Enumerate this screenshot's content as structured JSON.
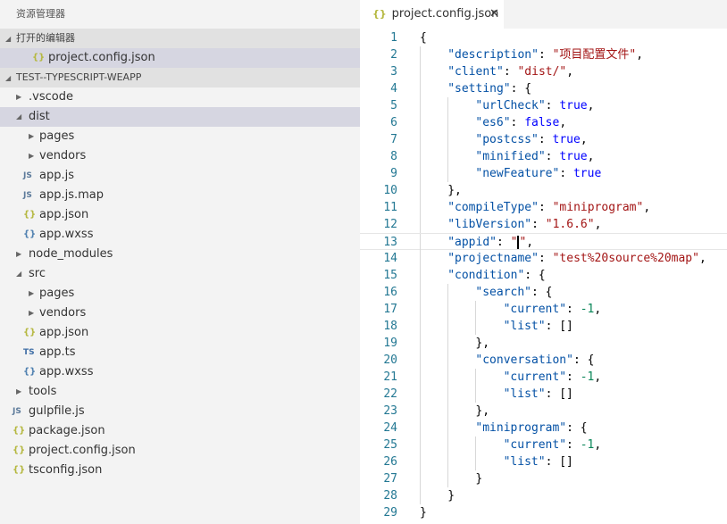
{
  "sidebar": {
    "title": "资源管理器",
    "open_editors_label": "打开的编辑器",
    "open_editors": [
      {
        "name": "project.config.json",
        "icon": "json"
      }
    ],
    "project_label": "TEST--TYPESCRIPT-WEAPP",
    "tree": [
      {
        "name": ".vscode",
        "type": "folder",
        "depth": 0,
        "expanded": false
      },
      {
        "name": "dist",
        "type": "folder",
        "depth": 0,
        "expanded": true,
        "selected": true
      },
      {
        "name": "pages",
        "type": "folder",
        "depth": 1,
        "expanded": false
      },
      {
        "name": "vendors",
        "type": "folder",
        "depth": 1,
        "expanded": false
      },
      {
        "name": "app.js",
        "type": "file",
        "icon": "js",
        "icon_text": "JS",
        "depth": 1
      },
      {
        "name": "app.js.map",
        "type": "file",
        "icon": "js",
        "icon_text": "JS",
        "depth": 1
      },
      {
        "name": "app.json",
        "type": "file",
        "icon": "json",
        "icon_text": "{}",
        "depth": 1
      },
      {
        "name": "app.wxss",
        "type": "file",
        "icon": "wxss",
        "icon_text": "{}",
        "depth": 1
      },
      {
        "name": "node_modules",
        "type": "folder",
        "depth": 0,
        "expanded": false
      },
      {
        "name": "src",
        "type": "folder",
        "depth": 0,
        "expanded": true
      },
      {
        "name": "pages",
        "type": "folder",
        "depth": 1,
        "expanded": false
      },
      {
        "name": "vendors",
        "type": "folder",
        "depth": 1,
        "expanded": false
      },
      {
        "name": "app.json",
        "type": "file",
        "icon": "json",
        "icon_text": "{}",
        "depth": 1
      },
      {
        "name": "app.ts",
        "type": "file",
        "icon": "ts",
        "icon_text": "TS",
        "depth": 1
      },
      {
        "name": "app.wxss",
        "type": "file",
        "icon": "wxss",
        "icon_text": "{}",
        "depth": 1
      },
      {
        "name": "tools",
        "type": "folder",
        "depth": 0,
        "expanded": false
      },
      {
        "name": "gulpfile.js",
        "type": "file",
        "icon": "js",
        "icon_text": "JS",
        "depth": 0
      },
      {
        "name": "package.json",
        "type": "file",
        "icon": "json",
        "icon_text": "{}",
        "depth": 0
      },
      {
        "name": "project.config.json",
        "type": "file",
        "icon": "json",
        "icon_text": "{}",
        "depth": 0
      },
      {
        "name": "tsconfig.json",
        "type": "file",
        "icon": "json",
        "icon_text": "{}",
        "depth": 0
      }
    ]
  },
  "editor": {
    "tab": {
      "label": "project.config.json",
      "icon_text": "{}",
      "close": "✕"
    },
    "cursor_line": 13,
    "lines": [
      [
        0,
        [
          [
            "p",
            "{"
          ]
        ]
      ],
      [
        1,
        [
          [
            "k",
            "\"description\""
          ],
          [
            "p",
            ": "
          ],
          [
            "s",
            "\"项目配置文件\""
          ],
          [
            "p",
            ","
          ]
        ]
      ],
      [
        1,
        [
          [
            "k",
            "\"client\""
          ],
          [
            "p",
            ": "
          ],
          [
            "s",
            "\"dist/\""
          ],
          [
            "p",
            ","
          ]
        ]
      ],
      [
        1,
        [
          [
            "k",
            "\"setting\""
          ],
          [
            "p",
            ": {"
          ]
        ]
      ],
      [
        2,
        [
          [
            "k",
            "\"urlCheck\""
          ],
          [
            "p",
            ": "
          ],
          [
            "b",
            "true"
          ],
          [
            "p",
            ","
          ]
        ]
      ],
      [
        2,
        [
          [
            "k",
            "\"es6\""
          ],
          [
            "p",
            ": "
          ],
          [
            "b",
            "false"
          ],
          [
            "p",
            ","
          ]
        ]
      ],
      [
        2,
        [
          [
            "k",
            "\"postcss\""
          ],
          [
            "p",
            ": "
          ],
          [
            "b",
            "true"
          ],
          [
            "p",
            ","
          ]
        ]
      ],
      [
        2,
        [
          [
            "k",
            "\"minified\""
          ],
          [
            "p",
            ": "
          ],
          [
            "b",
            "true"
          ],
          [
            "p",
            ","
          ]
        ]
      ],
      [
        2,
        [
          [
            "k",
            "\"newFeature\""
          ],
          [
            "p",
            ": "
          ],
          [
            "b",
            "true"
          ]
        ]
      ],
      [
        1,
        [
          [
            "p",
            "},"
          ]
        ]
      ],
      [
        1,
        [
          [
            "k",
            "\"compileType\""
          ],
          [
            "p",
            ": "
          ],
          [
            "s",
            "\"miniprogram\""
          ],
          [
            "p",
            ","
          ]
        ]
      ],
      [
        1,
        [
          [
            "k",
            "\"libVersion\""
          ],
          [
            "p",
            ": "
          ],
          [
            "s",
            "\"1.6.6\""
          ],
          [
            "p",
            ","
          ]
        ]
      ],
      [
        1,
        [
          [
            "k",
            "\"appid\""
          ],
          [
            "p",
            ": "
          ],
          [
            "s",
            "\""
          ],
          [
            "caret",
            ""
          ],
          [
            "s",
            "\""
          ],
          [
            "p",
            ","
          ]
        ]
      ],
      [
        1,
        [
          [
            "k",
            "\"projectname\""
          ],
          [
            "p",
            ": "
          ],
          [
            "s",
            "\"test%20source%20map\""
          ],
          [
            "p",
            ","
          ]
        ]
      ],
      [
        1,
        [
          [
            "k",
            "\"condition\""
          ],
          [
            "p",
            ": {"
          ]
        ]
      ],
      [
        2,
        [
          [
            "k",
            "\"search\""
          ],
          [
            "p",
            ": {"
          ]
        ]
      ],
      [
        3,
        [
          [
            "k",
            "\"current\""
          ],
          [
            "p",
            ": "
          ],
          [
            "n",
            "-1"
          ],
          [
            "p",
            ","
          ]
        ]
      ],
      [
        3,
        [
          [
            "k",
            "\"list\""
          ],
          [
            "p",
            ": []"
          ]
        ]
      ],
      [
        2,
        [
          [
            "p",
            "},"
          ]
        ]
      ],
      [
        2,
        [
          [
            "k",
            "\"conversation\""
          ],
          [
            "p",
            ": {"
          ]
        ]
      ],
      [
        3,
        [
          [
            "k",
            "\"current\""
          ],
          [
            "p",
            ": "
          ],
          [
            "n",
            "-1"
          ],
          [
            "p",
            ","
          ]
        ]
      ],
      [
        3,
        [
          [
            "k",
            "\"list\""
          ],
          [
            "p",
            ": []"
          ]
        ]
      ],
      [
        2,
        [
          [
            "p",
            "},"
          ]
        ]
      ],
      [
        2,
        [
          [
            "k",
            "\"miniprogram\""
          ],
          [
            "p",
            ": {"
          ]
        ]
      ],
      [
        3,
        [
          [
            "k",
            "\"current\""
          ],
          [
            "p",
            ": "
          ],
          [
            "n",
            "-1"
          ],
          [
            "p",
            ","
          ]
        ]
      ],
      [
        3,
        [
          [
            "k",
            "\"list\""
          ],
          [
            "p",
            ": []"
          ]
        ]
      ],
      [
        2,
        [
          [
            "p",
            "}"
          ]
        ]
      ],
      [
        1,
        [
          [
            "p",
            "}"
          ]
        ]
      ],
      [
        0,
        [
          [
            "p",
            "}"
          ]
        ]
      ]
    ]
  }
}
